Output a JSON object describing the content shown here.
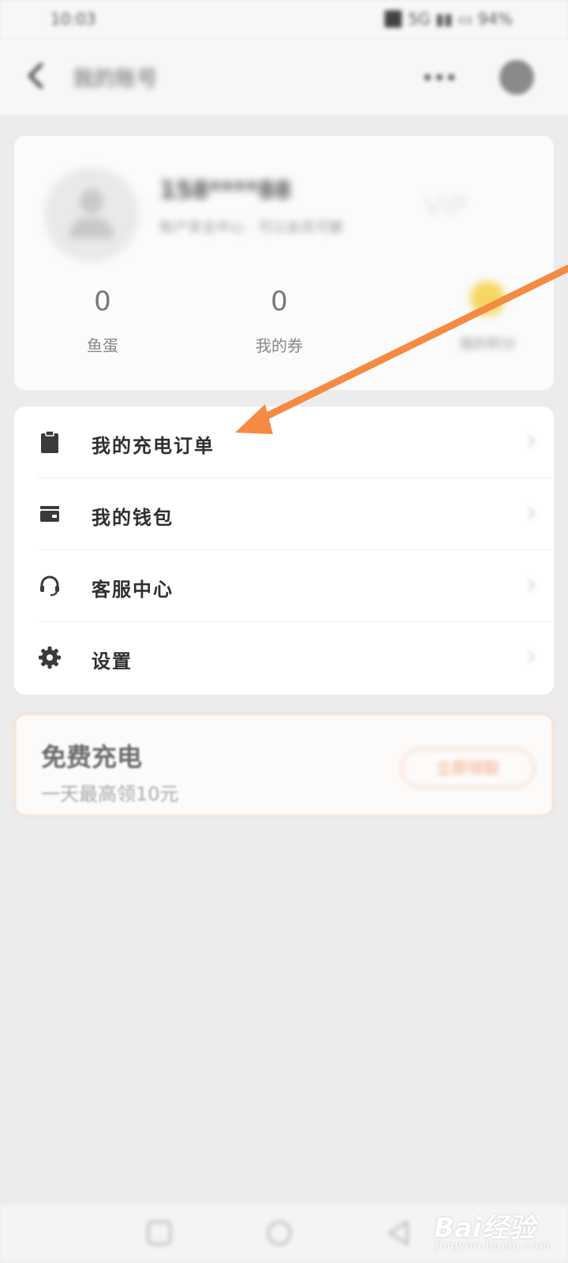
{
  "status_bar": {
    "time": "10:03",
    "right": "⬛ 5G ▮▮ ▭ 94%"
  },
  "header": {
    "title": "我的账号"
  },
  "profile": {
    "name": "158****88",
    "subtitle": "账户安全中心 · 可以会员可解",
    "vip_text": "VIP",
    "stats": [
      {
        "value": "0",
        "label": "鱼蛋"
      },
      {
        "value": "0",
        "label": "我的券"
      }
    ],
    "coin_label": "我的积分"
  },
  "menu": [
    {
      "label": "我的充电订单",
      "icon": "clipboard-icon"
    },
    {
      "label": "我的钱包",
      "icon": "wallet-icon"
    },
    {
      "label": "客服中心",
      "icon": "headset-icon"
    },
    {
      "label": "设置",
      "icon": "gear-icon"
    }
  ],
  "promo": {
    "title": "免费充电",
    "subtitle": "一天最高领10元",
    "button": "立即领取"
  },
  "watermark": {
    "main": "Bai经验",
    "sub": "jingyan.baidu.com"
  },
  "colors": {
    "arrow": "#f58a42",
    "accent": "#f1a07a"
  }
}
